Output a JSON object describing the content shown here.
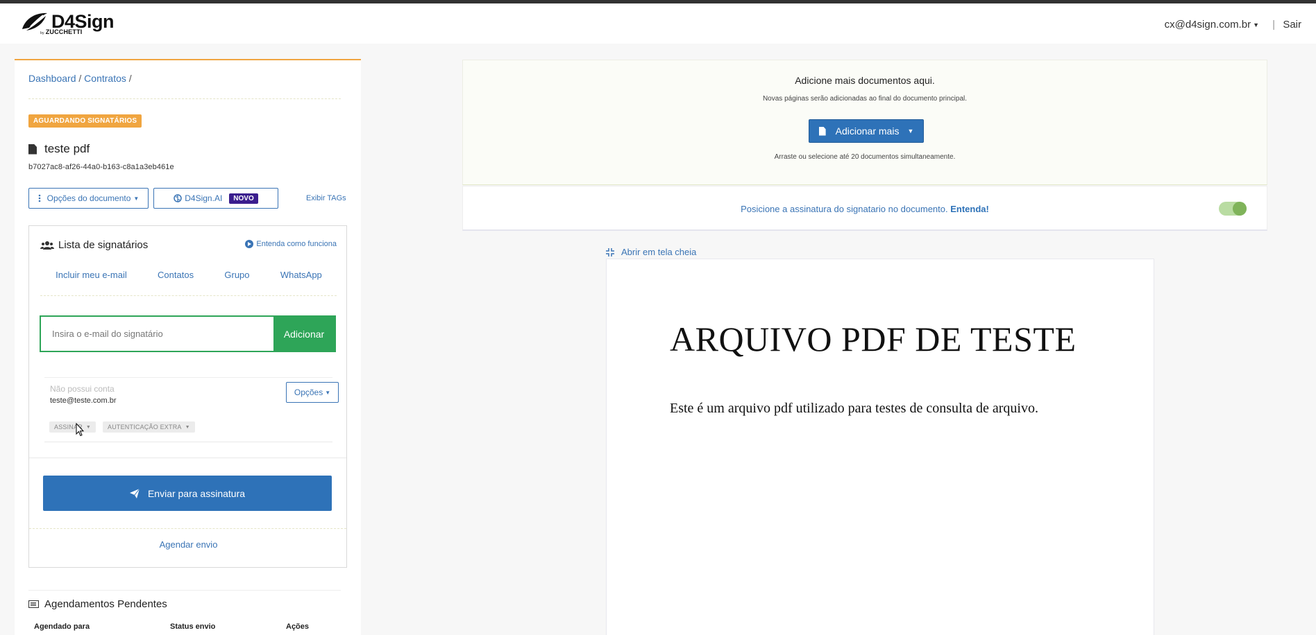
{
  "navbar": {
    "logo_text": "D4Sign",
    "logo_by": "by",
    "logo_sub": "ZUCCHETTI",
    "user_email": "cx@d4sign.com.br",
    "separator": "|",
    "logout_label": "Sair"
  },
  "breadcrumb": {
    "dashboard": "Dashboard",
    "contracts": "Contratos",
    "sep": "/"
  },
  "document": {
    "status": "AGUARDANDO SIGNATÁRIOS",
    "title": "teste pdf",
    "hash": "b7027ac8-af26-44a0-b163-c8a1a3eb461e",
    "options_label": "Opções do documento",
    "ai_label": "D4Sign.AI",
    "ai_badge": "NOVO",
    "tags_label": "Exibir TAGs"
  },
  "signers": {
    "title": "Lista de signatários",
    "how_label": "Entenda como funciona",
    "tabs": [
      "Incluir meu e-mail",
      "Contatos",
      "Grupo",
      "WhatsApp"
    ],
    "email_placeholder": "Insira o e-mail do signatário",
    "add_label": "Adicionar",
    "items": [
      {
        "name": "Não possui conta",
        "email": "teste@teste.com.br",
        "options_label": "Opções",
        "action_chip": "ASSINAR",
        "auth_chip": "AUTENTICAÇÃO EXTRA"
      }
    ],
    "send_label": "Enviar para assinatura",
    "schedule_label": "Agendar envio"
  },
  "pending": {
    "title": "Agendamentos Pendentes",
    "columns": [
      "Agendado para",
      "Status envio",
      "Ações"
    ]
  },
  "upload": {
    "title": "Adicione mais documentos aqui.",
    "subtitle": "Novas páginas serão adicionadas ao final do documento principal.",
    "add_more_label": "Adicionar mais",
    "hint": "Arraste ou selecione até 20 documentos simultaneamente."
  },
  "position_bar": {
    "text": "Posicione a assinatura do signatario no documento.",
    "link": "Entenda!",
    "toggle_on": true
  },
  "viewer": {
    "fullscreen_label": "Abrir em tela cheia",
    "heading": "ARQUIVO PDF DE TESTE",
    "body": "Este é um arquivo pdf utilizado para testes de consulta de arquivo."
  },
  "colors": {
    "accent_blue": "#2e72b8",
    "status_orange": "#f0a540",
    "success_green": "#2ea558",
    "ai_purple": "#3b1e8e"
  },
  "icons": [
    "d4sign-logo-icon",
    "file-icon",
    "ellipsis-vertical-icon",
    "brain-icon",
    "users-icon",
    "play-circle-icon",
    "paper-plane-icon",
    "list-icon",
    "compress-icon",
    "mouse-cursor-icon"
  ]
}
